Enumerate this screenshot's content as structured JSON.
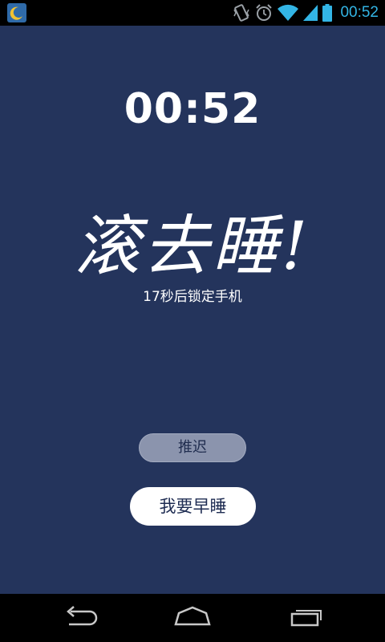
{
  "status_bar": {
    "time": "00:52",
    "icons": [
      "moon-app-icon",
      "vibrate-icon",
      "alarm-icon",
      "wifi-icon",
      "signal-icon",
      "battery-icon"
    ]
  },
  "main": {
    "countdown": "00:52",
    "headline": "滚去睡!",
    "subtitle": "17秒后锁定手机"
  },
  "buttons": {
    "postpone": "推迟",
    "sleep_now": "我要早睡"
  },
  "nav_bar": {
    "icons": [
      "back-icon",
      "home-icon",
      "recent-apps-icon"
    ]
  },
  "colors": {
    "background": "#24345c",
    "accent": "#33b5e5"
  }
}
